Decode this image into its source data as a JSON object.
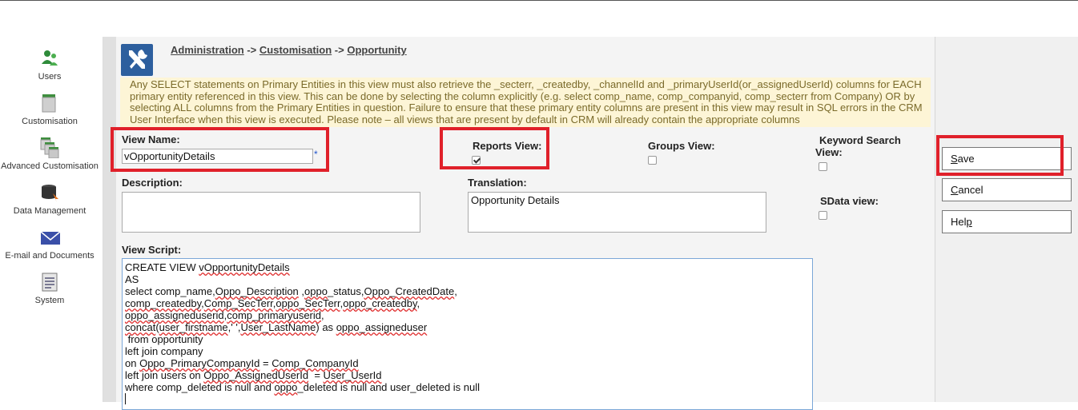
{
  "sidebar": {
    "items": [
      {
        "label": "Users",
        "icon": "users-icon"
      },
      {
        "label": "Customisation",
        "icon": "customisation-icon"
      },
      {
        "label": "Advanced Customisation",
        "icon": "advanced-customisation-icon"
      },
      {
        "label": "Data Management",
        "icon": "data-management-icon"
      },
      {
        "label": "E-mail and Documents",
        "icon": "email-icon"
      },
      {
        "label": "System",
        "icon": "system-icon"
      }
    ]
  },
  "breadcrumb": {
    "part1": "Administration",
    "sep1": " -> ",
    "part2": "Customisation",
    "sep2": " -> ",
    "part3": "Opportunity"
  },
  "notice": {
    "line1": "Any SELECT statements on Primary Entities in this view must also retrieve the _secterr, _createdby, _channelId and _primaryUserId(or_assignedUserId) columns for EACH",
    "line2": "primary entity referenced in this view. This can be done by selecting the column explicitly (e.g. select comp_name, comp_companyid, comp_secterr from Company) OR by",
    "line3": "selecting ALL columns from the Primary Entities in question. Failure to ensure that these primary entity columns are present in this view may result in SQL errors in the CRM",
    "line4": "User Interface when this view is executed. Please note – all views that are present by default in CRM will already contain the appropriate columns"
  },
  "form": {
    "view_name_label": "View Name:",
    "view_name_value": "vOpportunityDetails",
    "required_mark": "*",
    "reports_view_label": "Reports View:",
    "reports_view_checked": true,
    "groups_view_label": "Groups View:",
    "groups_view_checked": false,
    "keyword_search_label_1": "Keyword Search",
    "keyword_search_label_2": "View:",
    "keyword_search_checked": false,
    "description_label": "Description:",
    "description_value": "",
    "translation_label": "Translation:",
    "translation_value": "Opportunity Details",
    "sdata_view_label": "SData view:",
    "sdata_view_checked": false,
    "view_script_label": "View Script:"
  },
  "script": {
    "l1a": "CREATE VIEW ",
    "l1b": "vOpportunityDetails",
    "l2": "AS",
    "l3a": "select comp_name,",
    "l3b": "Oppo_Description",
    "l3c": " ,",
    "l3d": "oppo",
    "l3e": "_status,",
    "l3f": "Oppo_CreatedDate",
    "l3g": ",",
    "l4a": "comp_createdby",
    "l4b": ",",
    "l4c": "Comp_SecTerr",
    "l4d": ",",
    "l4e": "oppo_SecTerr",
    "l4f": ",",
    "l4g": "oppo_createdby",
    "l4h": ",",
    "l5a": "oppo_assigneduserid",
    "l5b": ",",
    "l5c": "comp_primaryuserid",
    "l5d": ",",
    "l6a": "concat",
    "l6b": "(",
    "l6c": "user_firstname",
    "l6d": ",' ',",
    "l6e": "User_LastName",
    "l6f": ") as ",
    "l6g": "oppo_assigneduser",
    "l7": " from opportunity",
    "l8": "left join company",
    "l9a": "on ",
    "l9b": "Oppo_PrimaryCompanyId",
    "l9c": " = ",
    "l9d": "Comp_CompanyId",
    "l10a": "left join users on ",
    "l10b": "Oppo_AssignedUserId",
    "l10c": "  = ",
    "l10d": "User_UserId",
    "l11a": "where comp_deleted is null and ",
    "l11b": "oppo",
    "l11c": "_deleted is null and user_deleted is null"
  },
  "buttons": {
    "save_u": "S",
    "save_rest": "ave",
    "cancel_u": "C",
    "cancel_rest": "ancel",
    "help_a": "Hel",
    "help_u": "p"
  },
  "colors": {
    "highlight": "#e0202a",
    "notice_bg": "#fdf5d6",
    "admin_icon_bg": "#2d5f9e"
  }
}
